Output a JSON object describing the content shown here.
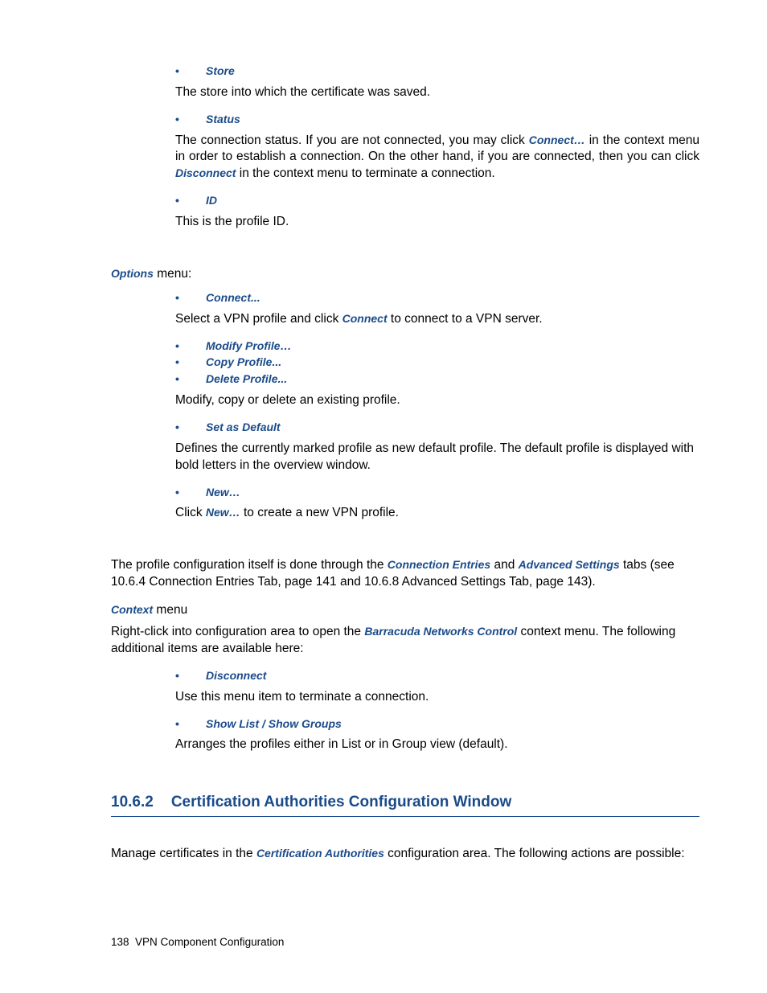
{
  "bullets": {
    "store": "Store",
    "status": "Status",
    "id": "ID",
    "connect": "Connect...",
    "modify_profile": "Modify Profile…",
    "copy_profile": "Copy Profile...",
    "delete_profile": "Delete Profile...",
    "set_default": "Set as Default",
    "new": "New…",
    "disconnect": "Disconnect",
    "show_list_groups": "Show List / Show Groups"
  },
  "text": {
    "store_desc": "The store into which the certificate was saved.",
    "status_desc_1": "The connection status. If you are not connected, you may click ",
    "status_term_connect": "Connect…",
    "status_desc_2": " in the context menu in order to establish a connection. On the other hand, if you are connected, then you can click ",
    "status_term_disconnect": "Disconnect",
    "status_desc_3": " in the context menu to terminate a connection.",
    "id_desc": "This is the profile ID.",
    "options_label": "Options",
    "options_menu_suffix": " menu:",
    "connect_desc_1": "Select a VPN profile and click ",
    "connect_term": "Connect",
    "connect_desc_2": " to connect to a VPN server.",
    "modify_desc": "Modify, copy or delete an existing profile.",
    "default_desc": "Defines the currently marked profile as new default profile. The default profile is displayed with bold letters in the overview window.",
    "new_desc_1": "Click ",
    "new_term": "New…",
    "new_desc_2": " to create a new VPN profile.",
    "tabs_desc_1": "The profile configuration itself is done through the ",
    "tabs_term_1": "Connection Entries",
    "tabs_desc_2": " and ",
    "tabs_term_2": "Advanced Settings",
    "tabs_desc_3": " tabs (see 10.6.4 Connection Entries Tab, page 141 and 10.6.8 Advanced Settings Tab, page 143).",
    "context_label": "Context",
    "context_suffix": " menu",
    "context_desc_1": "Right-click into configuration area to open the ",
    "context_term": "Barracuda Networks Control",
    "context_desc_2": " context menu. The following additional items are available here:",
    "disconnect_desc": "Use this menu item to terminate a connection.",
    "show_desc": "Arranges the profiles either in List or in Group view (default).",
    "cert_desc_1": "Manage certificates in the ",
    "cert_term": "Certification Authorities",
    "cert_desc_2": " configuration area. The following actions are possible:"
  },
  "heading": {
    "number": "10.6.2",
    "title": "Certification Authorities Configuration Window"
  },
  "footer": {
    "page_number": "138",
    "section": "VPN Component Configuration"
  }
}
